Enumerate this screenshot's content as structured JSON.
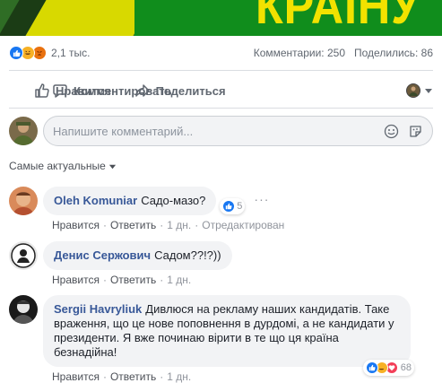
{
  "banner": {
    "text": "КРАЇНУ"
  },
  "stats": {
    "reaction_icons": [
      "like-icon",
      "haha-icon",
      "angry-icon"
    ],
    "reaction_count": "2,1 тыс.",
    "comments": "Комментарии: 250",
    "shares": "Поделились: 86"
  },
  "actions": {
    "like": "Нравится",
    "comment": "Комментировать",
    "share": "Поделиться"
  },
  "composer": {
    "placeholder": "Напишите комментарий..."
  },
  "sort": {
    "label": "Самые актуальные"
  },
  "comments": [
    {
      "author": "Oleh Komuniar",
      "text": "Садо-мазо?",
      "reactions": "5",
      "like": "Нравится",
      "reply": "Ответить",
      "time": "1 дн.",
      "edited": "Отредактирован"
    },
    {
      "author": "Денис Сержович",
      "text": "Садом??!?))",
      "like": "Нравится",
      "reply": "Ответить",
      "time": "1 дн."
    },
    {
      "author": "Sergii Havryliuk",
      "line1": "Дивлюся на рекламу наших кандидатів. Таке",
      "line2": "враження, що це нове поповнення в дурдомі, а не кандидати у",
      "line3": "президенти. Я вже починаю вірити в те що ця країна безнадійна!",
      "reactions": "68",
      "like": "Нравится",
      "reply": "Ответить",
      "time": "1 дн."
    }
  ],
  "colors": {
    "link": "#385898",
    "like_blue": "#1877f2",
    "muted": "#90949c",
    "bubble": "#f2f3f5"
  }
}
